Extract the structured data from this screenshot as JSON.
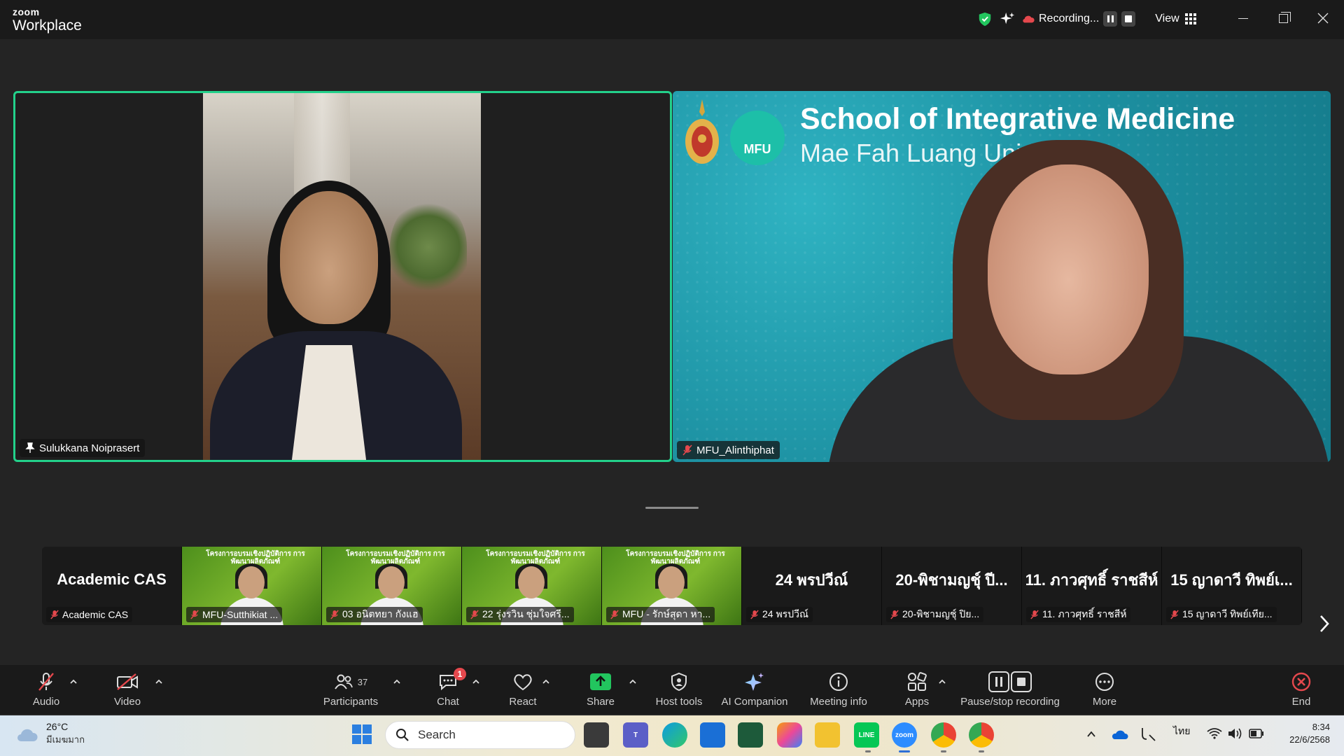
{
  "app": {
    "logo_small": "zoom",
    "logo_big": "Workplace"
  },
  "header": {
    "recording_label": "Recording...",
    "view_label": "View"
  },
  "meeting": {
    "left_tile": {
      "name": "Sulukkana Noiprasert"
    },
    "right_tile": {
      "name": "MFU_Alinthiphat",
      "banner_title": "School of Integrative Medicine",
      "banner_subtitle": "Mae Fah Luang University",
      "banner_logo_text": "MFU"
    }
  },
  "strip": {
    "thumbs": [
      {
        "type": "name",
        "display": "Academic CAS",
        "name": "Academic CAS"
      },
      {
        "type": "video",
        "banner": "โครงการอบรมเชิงปฏิบัติการ การพัฒนาผลิตภัณฑ์",
        "name": "MFU-Sutthikiat ..."
      },
      {
        "type": "video",
        "banner": "โครงการอบรมเชิงปฏิบัติการ การพัฒนาผลิตภัณฑ์",
        "name": "03 อนิตทยา กังแฮ"
      },
      {
        "type": "video",
        "banner": "โครงการอบรมเชิงปฏิบัติการ การพัฒนาผลิตภัณฑ์",
        "name": "22 รุ่งรวิน ชุ่มใจศรี..."
      },
      {
        "type": "video",
        "banner": "โครงการอบรมเชิงปฏิบัติการ การพัฒนาผลิตภัณฑ์",
        "name": "MFU - รักษ์สุดา หา..."
      },
      {
        "type": "name",
        "display": "24 พรปวีณ์",
        "name": "24 พรปวีณ์"
      },
      {
        "type": "name",
        "display": "20-พิชามญชุ์ ปี...",
        "name": "20-พิชามญชุ์ ปิย..."
      },
      {
        "type": "name",
        "display": "11. ภาวศุทธิ์ ราชสีห์",
        "name": "11. ภาวศุทธิ์ ราชสีห์"
      },
      {
        "type": "name",
        "display": "15 ญาดาวี ทิพย์เ...",
        "name": "15 ญาดาวี ทิพย์เทีย..."
      }
    ]
  },
  "toolbar": {
    "audio": "Audio",
    "video": "Video",
    "participants": "Participants",
    "participants_count": "37",
    "chat": "Chat",
    "chat_badge": "1",
    "react": "React",
    "share": "Share",
    "host_tools": "Host tools",
    "ai_companion": "AI Companion",
    "meeting_info": "Meeting info",
    "apps": "Apps",
    "pause_stop": "Pause/stop recording",
    "more": "More",
    "end": "End"
  },
  "taskbar": {
    "weather_temp": "26°C",
    "weather_desc": "มีเมฆมาก",
    "search_placeholder": "Search",
    "language": "ไทย",
    "time": "8:34",
    "date": "22/6/2568",
    "apps": [
      "task-view",
      "teams",
      "edge",
      "store",
      "solitaire",
      "copilot",
      "file-explorer",
      "line",
      "zoom",
      "chrome",
      "chrome-profile"
    ]
  },
  "colors": {
    "active_speaker_border": "#23d18b",
    "share_green": "#22c55e",
    "end_red": "#e5484d",
    "muted_red": "#e5484d"
  }
}
